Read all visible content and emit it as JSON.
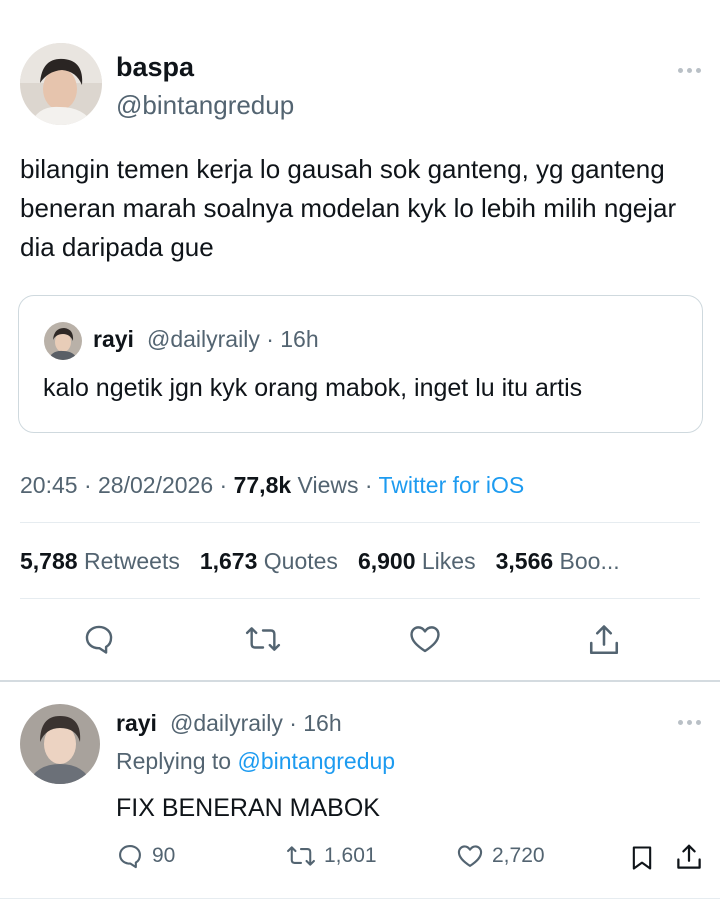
{
  "tweet": {
    "display_name": "baspa",
    "handle": "@bintangredup",
    "text": "bilangin temen kerja lo gausah sok ganteng, yg ganteng beneran marah soalnya modelan kyk lo lebih milih ngejar dia daripada gue",
    "time": "20:45",
    "date": "28/02/2026",
    "views_count": "77,8k",
    "views_label": "Views",
    "source": "Twitter for iOS",
    "sep": "·"
  },
  "quote": {
    "display_name": "rayi",
    "handle_time": "@dailyraily · 16h",
    "text": "kalo ngetik jgn kyk orang mabok, inget lu itu artis"
  },
  "stats": [
    {
      "count": "5,788",
      "label": "Retweets"
    },
    {
      "count": "1,673",
      "label": "Quotes"
    },
    {
      "count": "6,900",
      "label": "Likes"
    },
    {
      "count": "3,566",
      "label": "Boo..."
    }
  ],
  "reply": {
    "display_name": "rayi",
    "handle_time": "@dailyraily · 16h",
    "replying_label": "Replying to",
    "replying_handle": "@bintangredup",
    "text": "FIX BENERAN MABOK",
    "reply_count": "90",
    "retweet_count": "1,601",
    "like_count": "2,720"
  },
  "icons": {
    "action_color": "#536471",
    "link_color": "#1d9bf0"
  }
}
